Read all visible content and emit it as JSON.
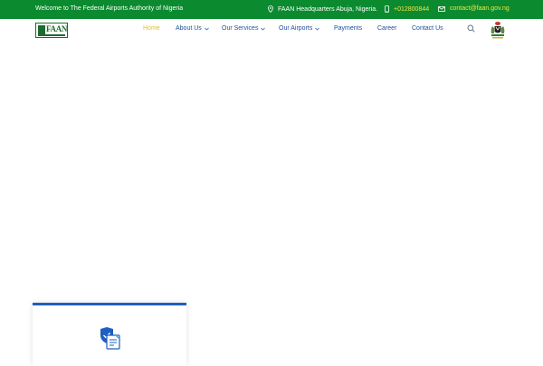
{
  "topbar": {
    "welcome": "Welcome to The Federal Airports Authority of Nigeria",
    "location": "FAAN Headquarters Abuja, Nigeria.",
    "phone": "+012800844",
    "email": "contact@faan.gov.ng",
    "icons": {
      "location": "map-pin-icon",
      "phone": "phone-icon",
      "email": "mail-icon"
    }
  },
  "brand": {
    "logo_text": "FAAN"
  },
  "nav": {
    "items": [
      {
        "label": "Home",
        "active": true,
        "dropdown": false
      },
      {
        "label": "About Us",
        "active": false,
        "dropdown": true
      },
      {
        "label": "Our Services",
        "active": false,
        "dropdown": true
      },
      {
        "label": "Our Airports",
        "active": false,
        "dropdown": true
      },
      {
        "label": "Payments",
        "active": false,
        "dropdown": false
      },
      {
        "label": "Career",
        "active": false,
        "dropdown": false
      },
      {
        "label": "Contact Us",
        "active": false,
        "dropdown": false
      }
    ]
  },
  "colors": {
    "topbar_bg": "#0b8a2f",
    "nav_text": "#1b4f9a",
    "nav_active": "#e6c11f",
    "highlight": "#f2e646",
    "card_accent": "#1e5fbf"
  },
  "card": {
    "icon": "shield-document-icon"
  }
}
